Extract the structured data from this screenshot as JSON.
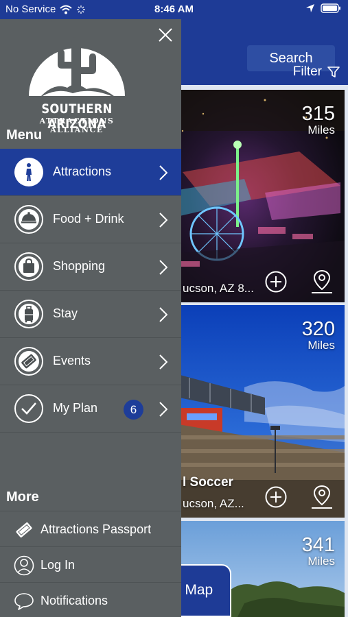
{
  "status_bar": {
    "carrier": "No Service",
    "time": "8:46 AM"
  },
  "header": {
    "search_label": "Search",
    "filter_label": "Filter"
  },
  "cards": [
    {
      "distance": "315",
      "unit": "Miles",
      "title": "",
      "address": "ucson, AZ 8..."
    },
    {
      "distance": "320",
      "unit": "Miles",
      "title": "l Soccer",
      "address": "ucson, AZ..."
    },
    {
      "distance": "341",
      "unit": "Miles",
      "title": "",
      "address": ""
    }
  ],
  "view_map_label": "v Map",
  "drawer": {
    "logo_line1": "SOUTHERN ARIZONA",
    "logo_line2": "ATTRACTIONS ALLIANCE",
    "menu_heading": "Menu",
    "menu_items": [
      {
        "label": "Attractions",
        "icon": "walking-person-icon",
        "active": true
      },
      {
        "label": "Food + Drink",
        "icon": "food-cloche-icon"
      },
      {
        "label": "Shopping",
        "icon": "shopping-bag-icon"
      },
      {
        "label": "Stay",
        "icon": "luggage-icon"
      },
      {
        "label": "Events",
        "icon": "ticket-icon"
      },
      {
        "label": "My Plan",
        "icon": "check-circle-icon",
        "badge": "6"
      }
    ],
    "more_heading": "More",
    "more_items": [
      {
        "label": "Attractions Passport",
        "icon": "passport-ticket-icon"
      },
      {
        "label": "Log In",
        "icon": "user-icon"
      },
      {
        "label": "Notifications",
        "icon": "chat-bubble-icon"
      }
    ]
  },
  "colors": {
    "brand_blue": "#1e3d99",
    "drawer_gray": "#5a5f61"
  }
}
